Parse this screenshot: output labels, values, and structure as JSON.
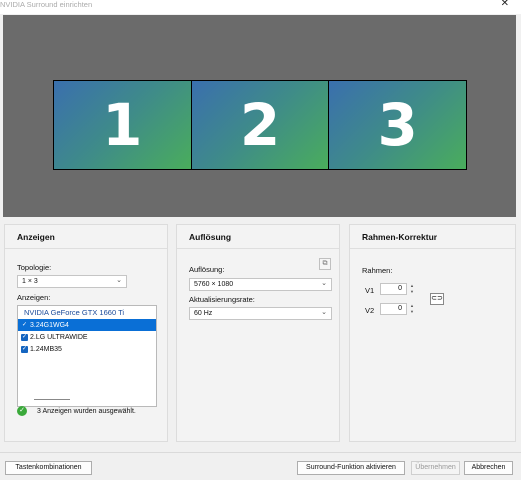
{
  "window": {
    "title": "NVIDIA Surround einrichten",
    "close_glyph": "✕"
  },
  "preview": {
    "displays": [
      "1",
      "2",
      "3"
    ]
  },
  "anzeigen": {
    "heading": "Anzeigen",
    "topology_label": "Topologie:",
    "topology_value": "1 × 3",
    "displays_label": "Anzeigen:",
    "gpu": "NVIDIA GeForce GTX 1660 Ti",
    "items": [
      {
        "label": "3.24G1WG4",
        "selected": true
      },
      {
        "label": "2.LG ULTRAWIDE",
        "selected": false
      },
      {
        "label": "1.24MB35",
        "selected": false
      }
    ],
    "status": "3 Anzeigen wurden ausgewählt."
  },
  "aufloesung": {
    "heading": "Auflösung",
    "res_label": "Auflösung:",
    "res_value": "5760 × 1080",
    "rate_label": "Aktualisierungsrate:",
    "rate_value": "60  Hz"
  },
  "rahmen": {
    "heading": "Rahmen-Korrektur",
    "label": "Rahmen:",
    "v1_label": "V1",
    "v1_value": "0",
    "v2_label": "V2",
    "v2_value": "0"
  },
  "footer": {
    "shortcuts": "Tastenkombinationen",
    "activate": "Surround-Funktion aktivieren",
    "apply": "Übernehmen",
    "cancel": "Abbrechen"
  },
  "icons": {
    "status": "checkmark-circle-icon",
    "resolution": "resolution-settings-icon",
    "link": "link-icon"
  },
  "colors": {
    "accent": "#0a6fd6",
    "success": "#3aa93a",
    "display_gradient": [
      "#3a6fae",
      "#4aad5c"
    ]
  }
}
